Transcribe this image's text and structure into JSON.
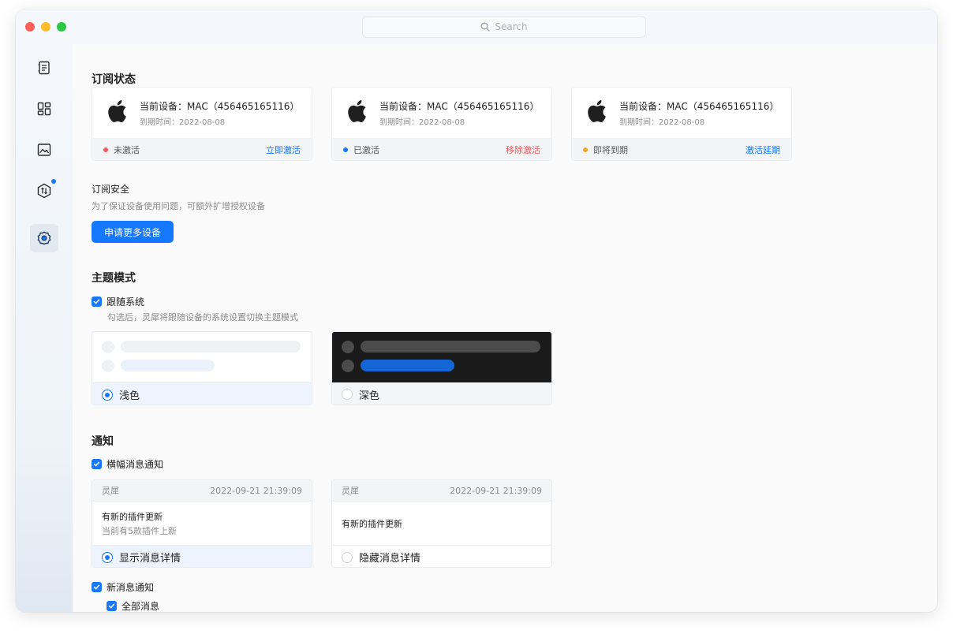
{
  "search": {
    "placeholder": "Search"
  },
  "sidebar": {
    "items": [
      {
        "icon": "notebook-icon"
      },
      {
        "icon": "dashboard-icon"
      },
      {
        "icon": "image-icon"
      },
      {
        "icon": "plugin-icon",
        "badge": true
      },
      {
        "icon": "settings-icon",
        "active": true
      }
    ]
  },
  "subscription": {
    "title": "订阅状态",
    "devices": [
      {
        "name": "当前设备：MAC（456465165116）",
        "expiry": "到期时间：2022-08-08",
        "status": "未激活",
        "status_color": "#f5595c",
        "action": "立即激活",
        "action_color": "#1677ff"
      },
      {
        "name": "当前设备：MAC（456465165116）",
        "expiry": "到期时间：2022-08-08",
        "status": "已激活",
        "status_color": "#1677ff",
        "action": "移除激活",
        "action_color": "#f5595c"
      },
      {
        "name": "当前设备：MAC（456465165116）",
        "expiry": "到期时间：2022-08-08",
        "status": "即将到期",
        "status_color": "#f5a623",
        "action": "激活延期",
        "action_color": "#1677ff"
      }
    ],
    "security_title": "订阅安全",
    "security_desc": "为了保证设备使用问题，可额外扩增授权设备",
    "apply_button": "申请更多设备"
  },
  "theme": {
    "title": "主题模式",
    "follow_label": "跟随系统",
    "follow_desc": "勾选后，灵犀将跟随设备的系统设置切换主题模式",
    "options": [
      {
        "label": "浅色",
        "selected": true
      },
      {
        "label": "深色",
        "selected": false
      }
    ]
  },
  "notify": {
    "title": "通知",
    "banner_label": "横幅消息通知",
    "previews": [
      {
        "app": "灵犀",
        "time": "2022-09-21 21:39:09",
        "title": "有新的插件更新",
        "subtitle": "当前有5款插件上新",
        "option": "显示消息详情",
        "selected": true
      },
      {
        "app": "灵犀",
        "time": "2022-09-21 21:39:09",
        "title": "有新的插件更新",
        "subtitle": "",
        "option": "隐藏消息详情",
        "selected": false
      }
    ],
    "new_msg_label": "新消息通知",
    "all_msg_label": "全部消息"
  },
  "colors": {
    "accent": "#1677ff",
    "dark_bg": "#1a1a1a"
  }
}
